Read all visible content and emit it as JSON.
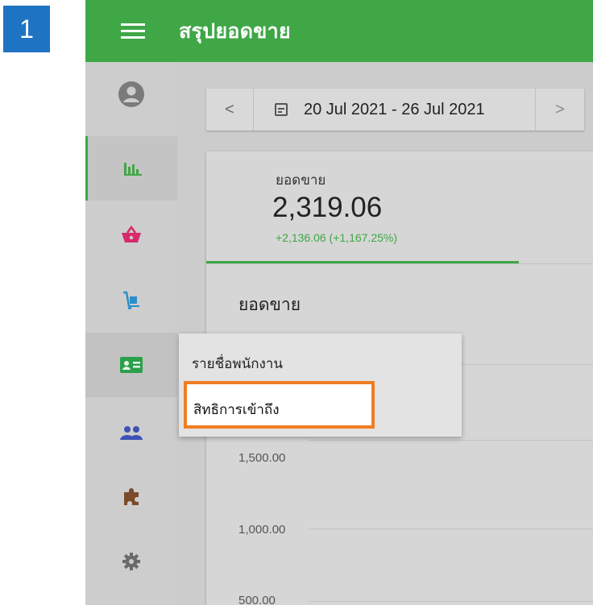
{
  "step_number": "1",
  "header": {
    "menu_icon": "hamburger-icon",
    "title": "สรุปยอดขาย"
  },
  "sidebar": {
    "items": [
      {
        "icon": "account-circle-icon",
        "color": "#7a7a7a"
      },
      {
        "icon": "bar-chart-icon",
        "color": "#3fa746",
        "active": true
      },
      {
        "icon": "shopping-basket-icon",
        "color": "#d62a6b"
      },
      {
        "icon": "hand-truck-icon",
        "color": "#2c8ec9"
      },
      {
        "icon": "id-card-icon",
        "color": "#2aa04a"
      },
      {
        "icon": "people-icon",
        "color": "#3f51b5"
      },
      {
        "icon": "puzzle-icon",
        "color": "#7b4a2a"
      },
      {
        "icon": "gear-icon",
        "color": "#6a6a6a"
      }
    ]
  },
  "date_range": {
    "prev_label": "<",
    "range": "20 Jul 2021 - 26 Jul 2021",
    "next_label": ">"
  },
  "kpi": {
    "label": "ยอดขาย",
    "value": "2,319.06",
    "change": "+2,136.06 (+1,167.25%)"
  },
  "chart": {
    "title": "ยอดขาย",
    "y_labels": [
      "1,500.00",
      "1,000.00",
      "500.00"
    ]
  },
  "popup_menu": {
    "items": [
      "รายชื่อพนักงาน",
      "สิทธิการเข้าถึง"
    ],
    "highlighted_index": 1
  },
  "colors": {
    "brand_green": "#3fa746",
    "step_blue": "#1f73c3",
    "highlight_orange": "#ef7d22"
  }
}
